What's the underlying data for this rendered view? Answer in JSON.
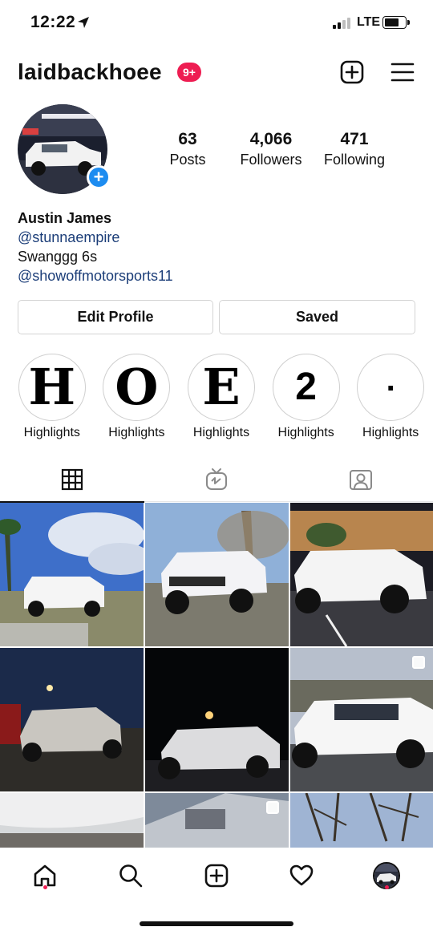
{
  "status_bar": {
    "time": "12:22",
    "network": "LTE"
  },
  "header": {
    "username": "laidbackhoee",
    "notification_badge": "9+"
  },
  "profile": {
    "stats": [
      {
        "number": "63",
        "label": "Posts"
      },
      {
        "number": "4,066",
        "label": "Followers"
      },
      {
        "number": "471",
        "label": "Following"
      }
    ],
    "bio": {
      "name": "Austin James",
      "mention_1": "@stunnaempire",
      "text": "Swanggg 6s",
      "mention_2": "@showoffmotorsports11"
    }
  },
  "buttons": {
    "edit_profile": "Edit Profile",
    "saved": "Saved"
  },
  "highlights": [
    {
      "symbol": "H",
      "label": "Highlights"
    },
    {
      "symbol": "O",
      "label": "Highlights"
    },
    {
      "symbol": "E",
      "label": "Highlights"
    },
    {
      "symbol": "2",
      "label": "Highlights"
    },
    {
      "symbol": ".",
      "label": "Highlights"
    }
  ],
  "tabs": [
    "grid-icon",
    "igtv-icon",
    "tagged-icon"
  ],
  "colors": {
    "badge": "#ee1d52",
    "link": "#1b3d78",
    "add_story": "#1d8cf0"
  },
  "bottom_nav": [
    "home-icon",
    "search-icon",
    "new-post-icon",
    "activity-heart-icon",
    "profile-avatar"
  ]
}
